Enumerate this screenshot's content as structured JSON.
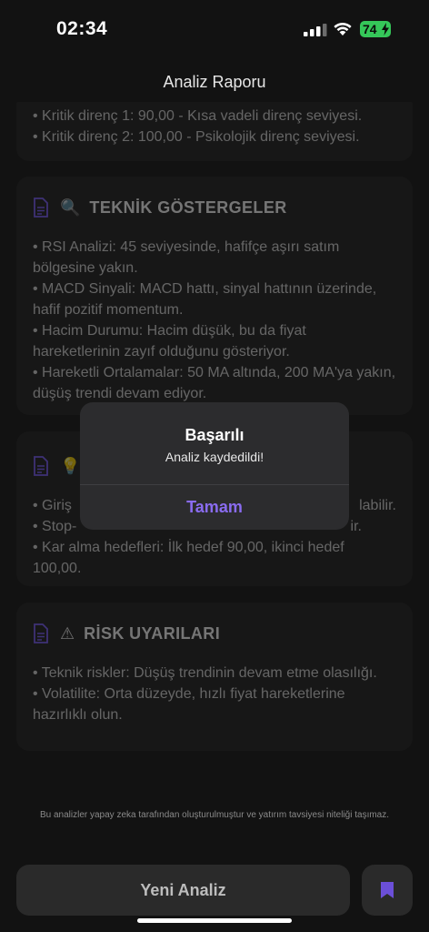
{
  "status": {
    "time": "02:34",
    "battery": "74"
  },
  "header": {
    "title": "Analiz Raporu"
  },
  "cards": [
    {
      "title": "",
      "emoji": "",
      "items": [
        "• Kritik direnç 1: 90,00 - Kısa vadeli direnç seviyesi.",
        "• Kritik direnç 2: 100,00 - Psikolojik direnç seviyesi."
      ]
    },
    {
      "title": "TEKNİK GÖSTERGELER",
      "emoji": "🔍",
      "items": [
        "• RSI Analizi: 45 seviyesinde, hafifçe aşırı satım bölgesine yakın.",
        "• MACD Sinyali: MACD hattı, sinyal hattının üzerinde, hafif pozitif momentum.",
        "• Hacim Durumu: Hacim düşük, bu da fiyat hareketlerinin zayıf olduğunu gösteriyor.",
        "• Hareketli Ortalamalar: 50 MA altında, 200 MA'ya yakın, düşüş trendi devam ediyor."
      ]
    },
    {
      "title": "",
      "emoji": "💡",
      "items": [
        "• Giriş",
        "labilir.",
        "• Stop-",
        "ir.",
        "• Kar alma hedefleri: İlk hedef 90,00, ikinci hedef 100,00."
      ]
    },
    {
      "title": "RİSK UYARILARI",
      "emoji": "⚠",
      "items": [
        "• Teknik riskler: Düşüş trendinin devam etme olasılığı.",
        "• Volatilite: Orta düzeyde, hızlı fiyat hareketlerine hazırlıklı olun."
      ]
    }
  ],
  "footer": {
    "disclaimer": "Bu analizler yapay zeka tarafından oluşturulmuştur ve yatırım tavsiyesi niteliği taşımaz.",
    "new_analysis": "Yeni Analiz"
  },
  "alert": {
    "title": "Başarılı",
    "message": "Analiz kaydedildi!",
    "button": "Tamam"
  },
  "colors": {
    "accent": "#8a6cf0",
    "battery": "#35c759",
    "card": "#1f1f1f"
  }
}
